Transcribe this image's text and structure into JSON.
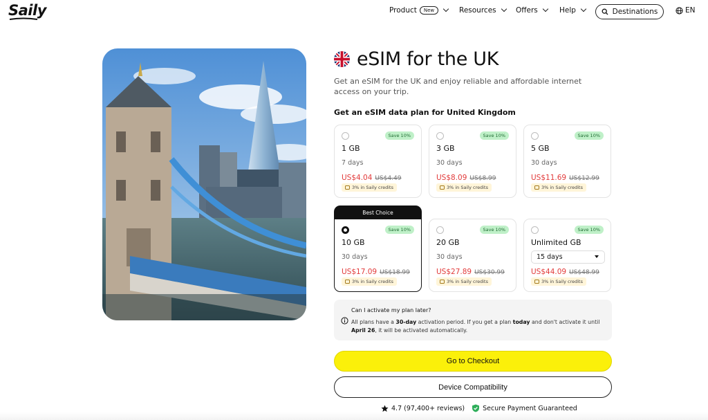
{
  "header": {
    "logo": "Saily",
    "nav": [
      {
        "label": "Product",
        "badge": "New"
      },
      {
        "label": "Resources"
      },
      {
        "label": "Offers"
      },
      {
        "label": "Help"
      }
    ],
    "destinations_label": "Destinations",
    "language": "EN"
  },
  "hero": {
    "title": "eSIM for the UK",
    "subtitle": "Get an eSIM for the UK and enjoy reliable and affordable internet access on your trip."
  },
  "plans_heading": "Get an eSIM data plan for United Kingdom",
  "best_choice_label": "Best Choice",
  "plans": [
    {
      "data": "1 GB",
      "days": "7 days",
      "price": "US$4.04",
      "old_price": "US$4.49",
      "save": "Save 10%",
      "credits": "3% in Saily credits"
    },
    {
      "data": "3 GB",
      "days": "30 days",
      "price": "US$8.09",
      "old_price": "US$8.99",
      "save": "Save 10%",
      "credits": "3% in Saily credits"
    },
    {
      "data": "5 GB",
      "days": "30 days",
      "price": "US$11.69",
      "old_price": "US$12.99",
      "save": "Save 10%",
      "credits": "3% in Saily credits"
    },
    {
      "data": "10 GB",
      "days": "30 days",
      "price": "US$17.09",
      "old_price": "US$18.99",
      "save": "Save 10%",
      "credits": "3% in Saily credits"
    },
    {
      "data": "20 GB",
      "days": "30 days",
      "price": "US$27.89",
      "old_price": "US$30.99",
      "save": "Save 10%",
      "credits": "3% in Saily credits"
    },
    {
      "data": "Unlimited GB",
      "days": "15 days",
      "price": "US$44.09",
      "old_price": "US$48.99",
      "save": "Save 10%",
      "credits": "3% in Saily credits"
    }
  ],
  "selected_plan": "10 GB",
  "info": {
    "question": "Can I activate my plan later?",
    "answer_1": "All plans have a ",
    "answer_2": "30-day",
    "answer_3": " activation period. If you get a plan ",
    "answer_4": "today",
    "answer_5": " and don't activate it until ",
    "answer_6": "April 26",
    "answer_7": ", it will be activated automatically."
  },
  "checkout_label": "Go to Checkout",
  "compatibility_label": "Device Compatibility",
  "rating_text": "4.7 (97,400+ reviews)",
  "secure_text": "Secure Payment Guaranteed",
  "colors": {
    "accent": "#fbf00a",
    "price_red": "#e23b3b",
    "save_green": "#bff0c8"
  }
}
